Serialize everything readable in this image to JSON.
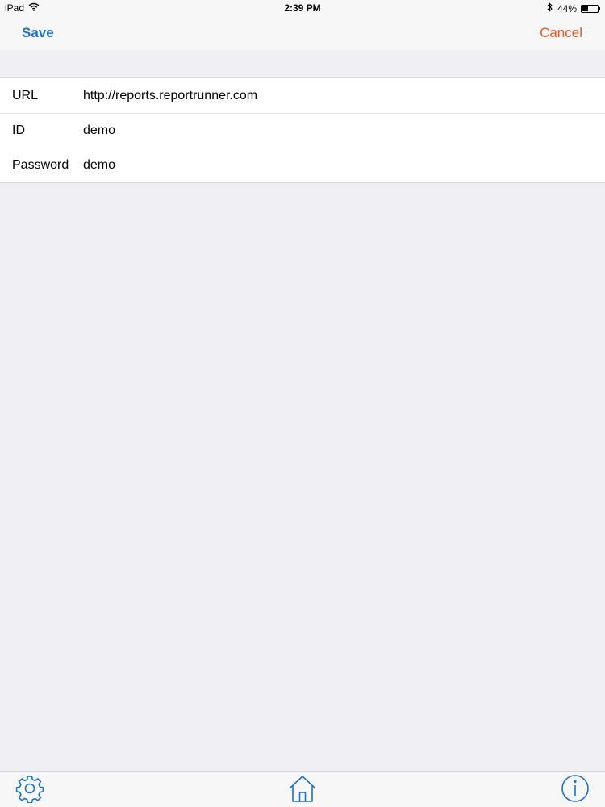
{
  "status_bar": {
    "device": "iPad",
    "time": "2:39 PM",
    "battery": "44%",
    "battery_level": 0.44,
    "icons": [
      "wifi-icon",
      "bluetooth-icon",
      "battery-icon"
    ]
  },
  "nav": {
    "save_label": "Save",
    "cancel_label": "Cancel"
  },
  "form": {
    "rows": [
      {
        "label": "URL",
        "value": "http://reports.reportrunner.com"
      },
      {
        "label": "ID",
        "value": "demo"
      },
      {
        "label": "Password",
        "value": "demo"
      }
    ]
  },
  "toolbar": {
    "icons": [
      "gear-icon",
      "home-icon",
      "info-icon"
    ]
  },
  "colors": {
    "accent_blue": "#1a73c9",
    "cancel_orange": "#e8551a",
    "background": "#efeff4"
  }
}
